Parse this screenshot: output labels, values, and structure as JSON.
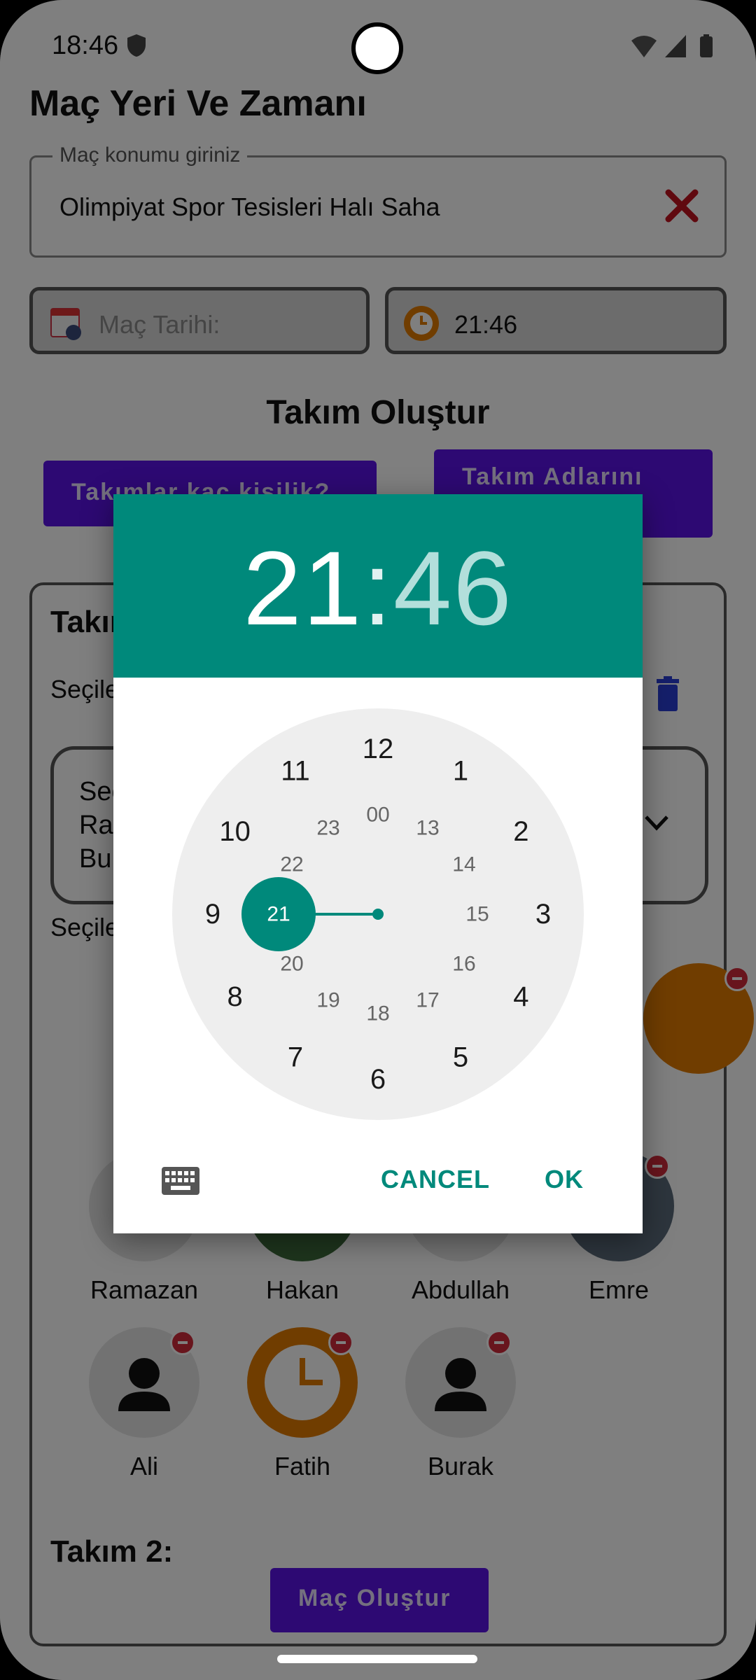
{
  "status_bar": {
    "time": "18:46"
  },
  "screen": {
    "title": "Maç Yeri Ve Zamanı",
    "location": {
      "label": "Maç konumu giriniz",
      "value": "Olimpiyat Spor Tesisleri Halı Saha"
    },
    "date_picker": {
      "placeholder": "Maç Tarihi:"
    },
    "time_picker": {
      "value": "21:46"
    },
    "team_section_title": "Takım Oluştur",
    "buttons": {
      "team_size": "Takımlar kaç kişilik?",
      "team_names": "Takım Adlarını",
      "create_match": "Maç Oluştur"
    },
    "team1": {
      "title": "Takım 1:",
      "selected_label": "Seçilen",
      "dropdown_lines": [
        "Seç",
        "Ra",
        "Bu"
      ],
      "selected_label2": "Seçilen"
    },
    "players_row2": [
      "Ramazan",
      "Hakan",
      "Abdullah",
      "Emre"
    ],
    "players_row3": [
      "Ali",
      "Fatih",
      "Burak"
    ],
    "team2_title": "Takım 2:"
  },
  "dialog": {
    "hour": "21",
    "separator": ":",
    "minute": "46",
    "outer_numbers": [
      "12",
      "1",
      "2",
      "3",
      "4",
      "5",
      "6",
      "7",
      "8",
      "9",
      "10",
      "11"
    ],
    "inner_numbers": [
      "00",
      "13",
      "14",
      "15",
      "16",
      "17",
      "18",
      "19",
      "20",
      "21",
      "22",
      "23"
    ],
    "selected_hour": "21",
    "cancel_label": "CANCEL",
    "ok_label": "OK"
  },
  "colors": {
    "accent": "#00897b",
    "purple": "#5b12e6",
    "orange": "#e07b00",
    "danger": "#d12b3a"
  }
}
